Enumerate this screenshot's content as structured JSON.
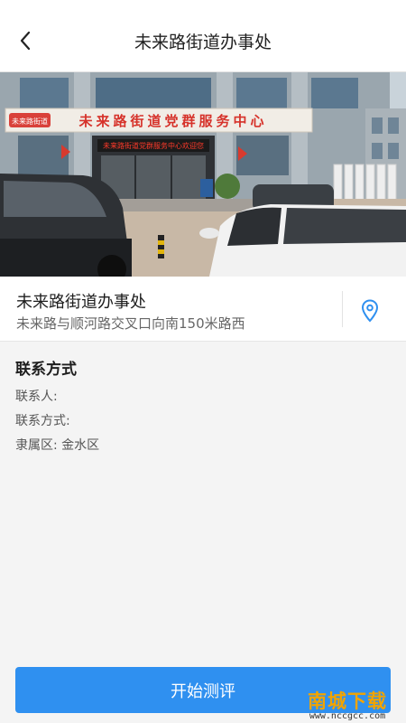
{
  "header": {
    "title": "未来路街道办事处",
    "back_icon": "chevron-left-icon"
  },
  "hero": {
    "sign_text": "未来路街道党群服务中心",
    "banner_text": "未来路街道党群服务中心欢迎您",
    "logo_text": "未来路街道"
  },
  "office": {
    "name": "未来路街道办事处",
    "address": "未来路与顺河路交叉口向南150米路西",
    "location_icon": "map-pin-icon"
  },
  "contact": {
    "heading": "联系方式",
    "contact_person": "联系人:",
    "contact_method": "联系方式:",
    "district": "隶属区: 金水区"
  },
  "actions": {
    "start_label": "开始测评"
  },
  "watermark": {
    "title": "南城下载",
    "url": "www.nccgcc.com"
  },
  "colors": {
    "accent": "#2f90f0",
    "background": "#f4f4f4",
    "watermark": "#f2a400"
  }
}
